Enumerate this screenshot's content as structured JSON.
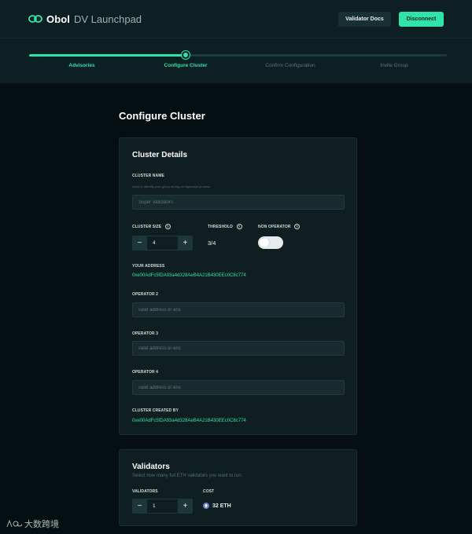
{
  "app": {
    "brand": "Obol",
    "product": "DV Launchpad"
  },
  "header": {
    "docs_label": "Validator Docs",
    "disconnect_label": "Disconnect"
  },
  "steps": [
    {
      "label": "Advisories",
      "state": "done"
    },
    {
      "label": "Configure Cluster",
      "state": "current"
    },
    {
      "label": "Confirm Configuration",
      "state": "todo"
    },
    {
      "label": "Invite Group",
      "state": "todo"
    }
  ],
  "page": {
    "title": "Configure Cluster"
  },
  "cluster": {
    "title": "Cluster Details",
    "name_label": "CLUSTER NAME",
    "name_hint": "Used to identify your group during configuration process",
    "name_placeholder": "Super Validators",
    "size_label": "CLUSTER SIZE",
    "size_value": "4",
    "threshold_label": "THRESHOLD",
    "threshold_value": "3/4",
    "non_operator_label": "NON OPERATOR",
    "non_operator_on": false,
    "your_address_label": "YOUR ADDRESS",
    "your_address": "0xe00AdFc5fDA93a4d328AeB4A21B430EEc0C8c774",
    "operators": [
      {
        "label": "OPERATOR 2",
        "placeholder": "valid address or ens"
      },
      {
        "label": "OPERATOR 3",
        "placeholder": "valid address or ens"
      },
      {
        "label": "OPERATOR 4",
        "placeholder": "valid address or ens"
      }
    ],
    "created_by_label": "CLUSTER CREATED BY",
    "created_by": "0xe00AdFc5fDA93a4d328AeB4A21B430EEc0C8c774"
  },
  "validators": {
    "title": "Validators",
    "subtitle": "Select how many full ETH validators you want to run.",
    "count_label": "VALIDATORS",
    "count_value": "1",
    "cost_label": "COST",
    "cost_value": "32 ETH"
  },
  "stepper_symbols": {
    "minus": "−",
    "plus": "+"
  },
  "help_symbol": "?",
  "watermark": "大数跨境",
  "colors": {
    "accent": "#2fe4ab",
    "background": "#050f11",
    "panel": "#0d1f23"
  }
}
